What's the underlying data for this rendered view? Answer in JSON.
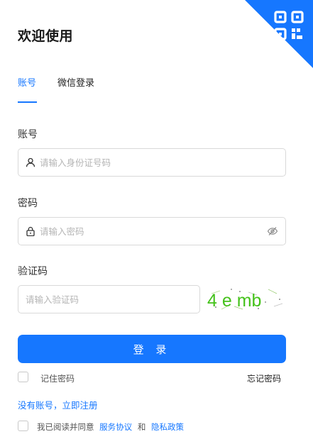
{
  "header": {
    "title": "欢迎使用",
    "qr_icon": "qr-code-icon",
    "accent_color": "#1677ff"
  },
  "tabs": [
    {
      "label": "账号",
      "active": true
    },
    {
      "label": "微信登录",
      "active": false
    }
  ],
  "form": {
    "account": {
      "label": "账号",
      "placeholder": "请输入身份证号码",
      "value": "",
      "icon": "user-icon"
    },
    "password": {
      "label": "密码",
      "placeholder": "请输入密码",
      "value": "",
      "icon": "lock-icon",
      "toggle_icon": "eye-off-icon"
    },
    "captcha": {
      "label": "验证码",
      "placeholder": "请输入验证码",
      "value": "",
      "image_text": "4 e mb"
    }
  },
  "login_button": {
    "label": "登 录"
  },
  "remember": {
    "label": "记住密码",
    "checked": false
  },
  "forgot": {
    "label": "忘记密码"
  },
  "register": {
    "label": "没有账号，立即注册"
  },
  "agreement": {
    "prefix": "我已阅读并同意",
    "terms": "服务协议",
    "and": "和",
    "privacy": "隐私政策",
    "checked": false
  }
}
